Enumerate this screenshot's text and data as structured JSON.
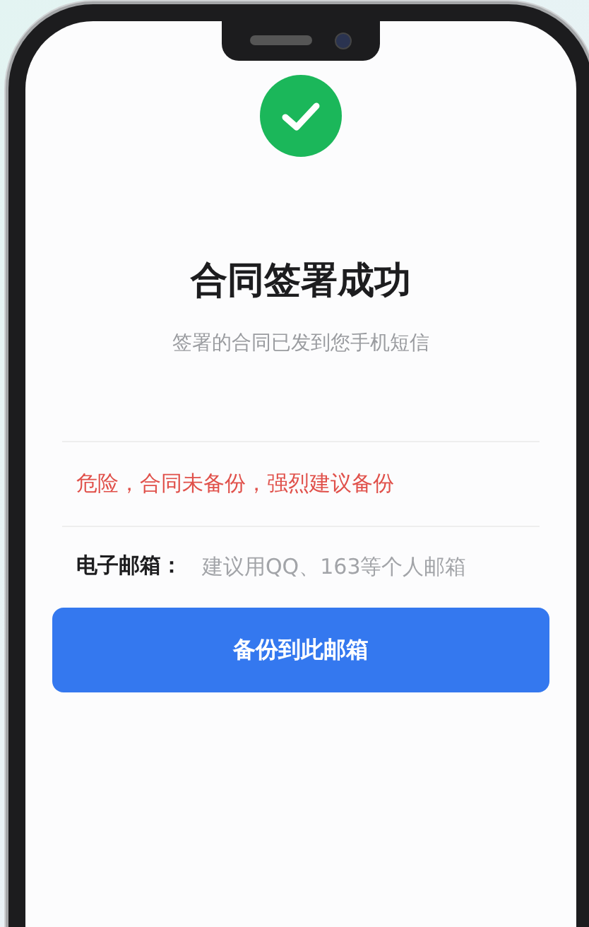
{
  "status": {
    "kind": "success"
  },
  "title": "合同签署成功",
  "subtitle": "签署的合同已发到您手机短信",
  "warning": "危险，合同未备份，强烈建议备份",
  "email_field": {
    "label": "电子邮箱：",
    "placeholder": "建议用QQ、163等个人邮箱"
  },
  "button": "备份到此邮箱"
}
